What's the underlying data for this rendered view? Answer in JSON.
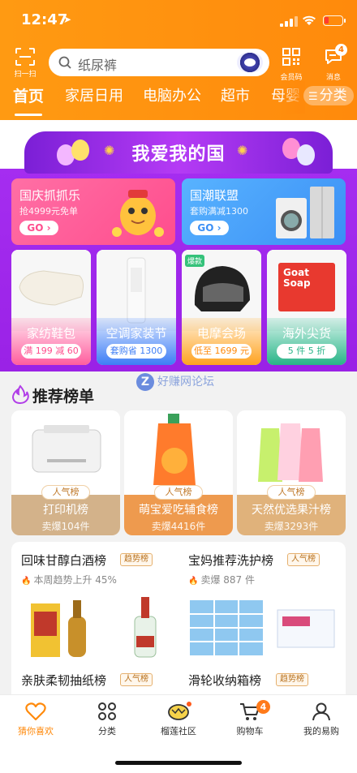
{
  "status_bar": {
    "time": "12:47"
  },
  "header": {
    "scan_label": "扫一扫",
    "search_placeholder": "纸尿裤",
    "member_label": "会员码",
    "message_label": "消息",
    "message_badge": "4"
  },
  "tabs": [
    "首页",
    "家居日用",
    "电脑办公",
    "超市",
    "母婴"
  ],
  "category_button": "分类",
  "promo": {
    "banner_title": "我爱我的国",
    "big_cards": [
      {
        "title": "国庆抓抓乐",
        "subtitle": "抢4999元免单",
        "go": "GO"
      },
      {
        "title": "国潮联盟",
        "subtitle": "套购满减1300",
        "go": "GO"
      }
    ],
    "small_cards": [
      {
        "name": "家纺鞋包",
        "pill": "满 199 减 60"
      },
      {
        "name": "空调家装节",
        "pill": "套购省 1300"
      },
      {
        "name": "电摩会场",
        "pill": "低至 1699 元",
        "corner_tag": "爆款"
      },
      {
        "name": "海外尖货",
        "pill": "5 件 5 折",
        "product_text": [
          "Goat",
          "Soap"
        ]
      }
    ]
  },
  "recommend": {
    "title": "推荐榜单",
    "watermark": "好赚网论坛",
    "cards": [
      {
        "tag": "人气榜",
        "name": "打印机榜",
        "sold": "卖爆104件"
      },
      {
        "tag": "人气榜",
        "name": "萌宝爱吃辅食榜",
        "sold": "卖爆4416件"
      },
      {
        "tag": "人气榜",
        "name": "天然优选果汁榜",
        "sold": "卖爆3293件"
      }
    ],
    "rank_lists": [
      {
        "name": "回味甘醇白酒榜",
        "badge": "趋势榜",
        "sub": "本周趋势上升 45%"
      },
      {
        "name": "宝妈推荐洗护榜",
        "badge": "人气榜",
        "sub": "卖爆 887 件"
      },
      {
        "name": "亲肤柔韧抽纸榜",
        "badge": "人气榜"
      },
      {
        "name": "滑轮收纳箱榜",
        "badge": "趋势榜"
      }
    ]
  },
  "bottom_nav": [
    {
      "label": "猜你喜欢",
      "icon": "heart-icon",
      "active": true
    },
    {
      "label": "分类",
      "icon": "grid-icon"
    },
    {
      "label": "榴莲社区",
      "icon": "durian-icon"
    },
    {
      "label": "购物车",
      "icon": "cart-icon",
      "badge": "4"
    },
    {
      "label": "我的易购",
      "icon": "user-icon"
    }
  ],
  "colors": {
    "brand_orange": "#ff8a0c",
    "promo_purple": "#a52df0"
  }
}
